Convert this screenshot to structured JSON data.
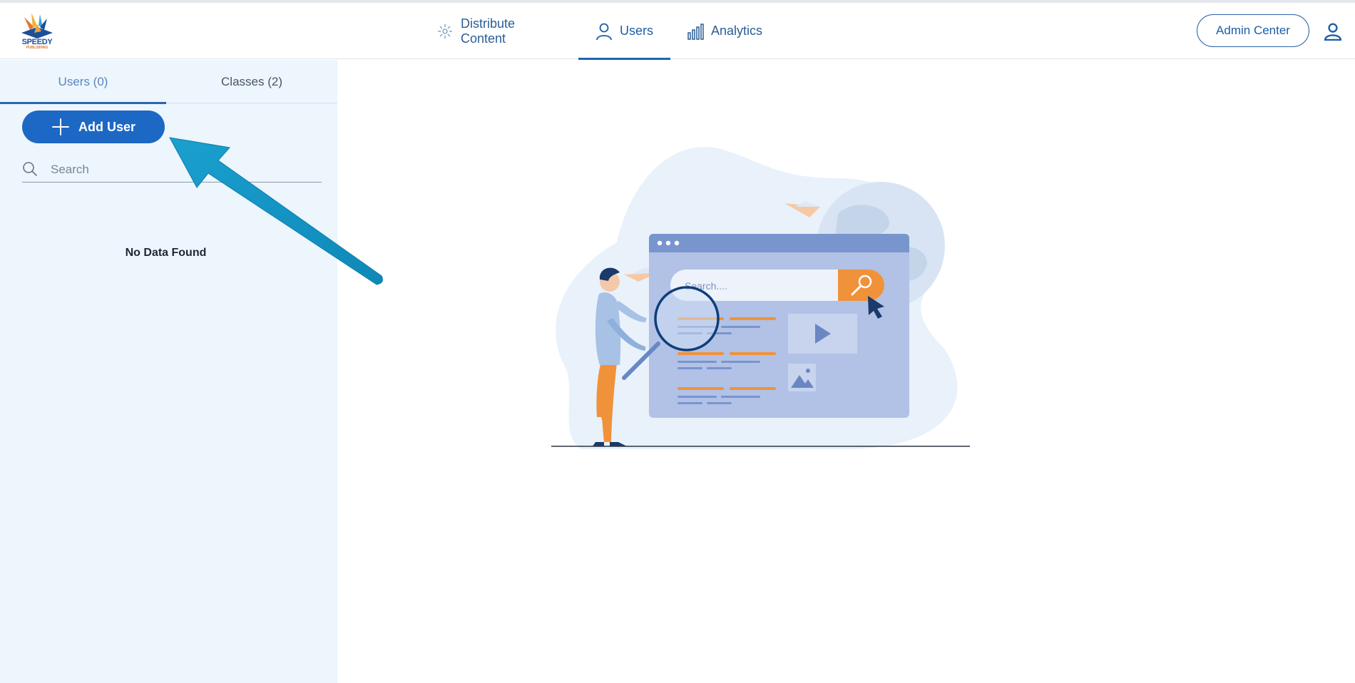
{
  "header": {
    "logo": {
      "text": "SPEEDY",
      "subtext": "PUBLISHING"
    },
    "nav": [
      {
        "label": "Distribute Content",
        "icon": "distribute-icon",
        "active": false
      },
      {
        "label": "Users",
        "icon": "user-icon",
        "active": true
      },
      {
        "label": "Analytics",
        "icon": "analytics-icon",
        "active": false
      }
    ],
    "admin_center_label": "Admin Center",
    "profile_icon": "profile-icon"
  },
  "sidebar": {
    "tabs": [
      {
        "label": "Users (0)",
        "active": true
      },
      {
        "label": "Classes (2)",
        "active": false
      }
    ],
    "add_user_label": "Add User",
    "search": {
      "placeholder": "Search",
      "value": ""
    },
    "empty_message": "No Data Found"
  },
  "illustration": {
    "search_placeholder": "Search...."
  },
  "colors": {
    "primary": "#1c68c4",
    "nav_text": "#2a5d96",
    "sidebar_bg": "#edf5fd",
    "annotation_arrow": "#1796c4",
    "accent_orange": "#f0923a"
  }
}
